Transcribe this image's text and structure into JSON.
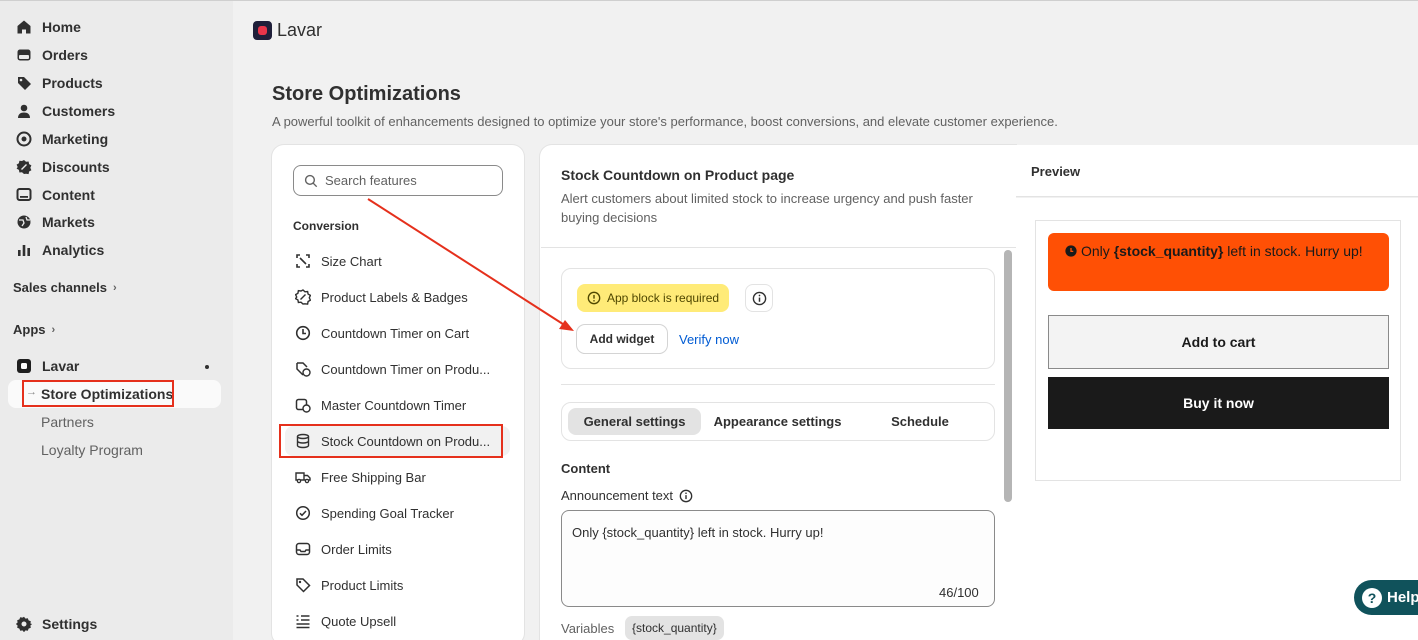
{
  "sidebar": {
    "nav": [
      {
        "label": "Home",
        "icon": "home-icon"
      },
      {
        "label": "Orders",
        "icon": "orders-icon"
      },
      {
        "label": "Products",
        "icon": "tag-icon"
      },
      {
        "label": "Customers",
        "icon": "person-icon"
      },
      {
        "label": "Marketing",
        "icon": "target-icon"
      },
      {
        "label": "Discounts",
        "icon": "discount-icon"
      },
      {
        "label": "Content",
        "icon": "content-icon"
      },
      {
        "label": "Markets",
        "icon": "globe-icon"
      },
      {
        "label": "Analytics",
        "icon": "chart-icon"
      }
    ],
    "sales_channels": "Sales channels",
    "apps": "Apps",
    "app_name": "Lavar",
    "app_subitems": [
      "Store Optimizations",
      "Partners",
      "Loyalty Program"
    ],
    "settings": "Settings"
  },
  "header": {
    "app_name": "Lavar"
  },
  "page": {
    "title": "Store Optimizations",
    "subtitle": "A powerful toolkit of enhancements designed to optimize your store's performance, boost conversions, and elevate customer experience."
  },
  "features": {
    "search_placeholder": "Search features",
    "group": "Conversion",
    "items": [
      {
        "label": "Size Chart",
        "icon": "ruler-icon"
      },
      {
        "label": "Product Labels & Badges",
        "icon": "badge-icon"
      },
      {
        "label": "Countdown Timer on Cart",
        "icon": "clock-icon"
      },
      {
        "label": "Countdown Timer on Produ...",
        "icon": "tag-clock-icon"
      },
      {
        "label": "Master Countdown Timer",
        "icon": "calendar-clock-icon"
      },
      {
        "label": "Stock Countdown on Produ...",
        "icon": "database-icon"
      },
      {
        "label": "Free Shipping Bar",
        "icon": "truck-icon"
      },
      {
        "label": "Spending Goal Tracker",
        "icon": "check-circle-icon"
      },
      {
        "label": "Order Limits",
        "icon": "inbox-icon"
      },
      {
        "label": "Product Limits",
        "icon": "tag-icon"
      },
      {
        "label": "Quote Upsell",
        "icon": "list-icon"
      }
    ]
  },
  "settings": {
    "title": "Stock Countdown on Product page",
    "description": "Alert customers about limited stock to increase urgency and push faster buying decisions",
    "warning": "App block is required",
    "add_widget": "Add widget",
    "verify": "Verify now",
    "tabs": [
      "General settings",
      "Appearance settings",
      "Schedule"
    ],
    "content_label": "Content",
    "announcement_label": "Announcement text",
    "announcement_value": "Only {stock_quantity} left in stock. Hurry up!",
    "char_count": "46/100",
    "variables_label": "Variables",
    "variable_chip": "{stock_quantity}"
  },
  "preview": {
    "title": "Preview",
    "alert_prefix": "Only ",
    "alert_var": "{stock_quantity}",
    "alert_suffix": " left in stock. Hurry up!",
    "add_to_cart": "Add to cart",
    "buy_now": "Buy it now"
  },
  "help": "Help",
  "colors": {
    "alert_bg": "#ff5005",
    "warning_bg": "#ffeb78",
    "link": "#005bd3",
    "annotation_red": "#e5301c",
    "help_bg": "#10525b"
  }
}
